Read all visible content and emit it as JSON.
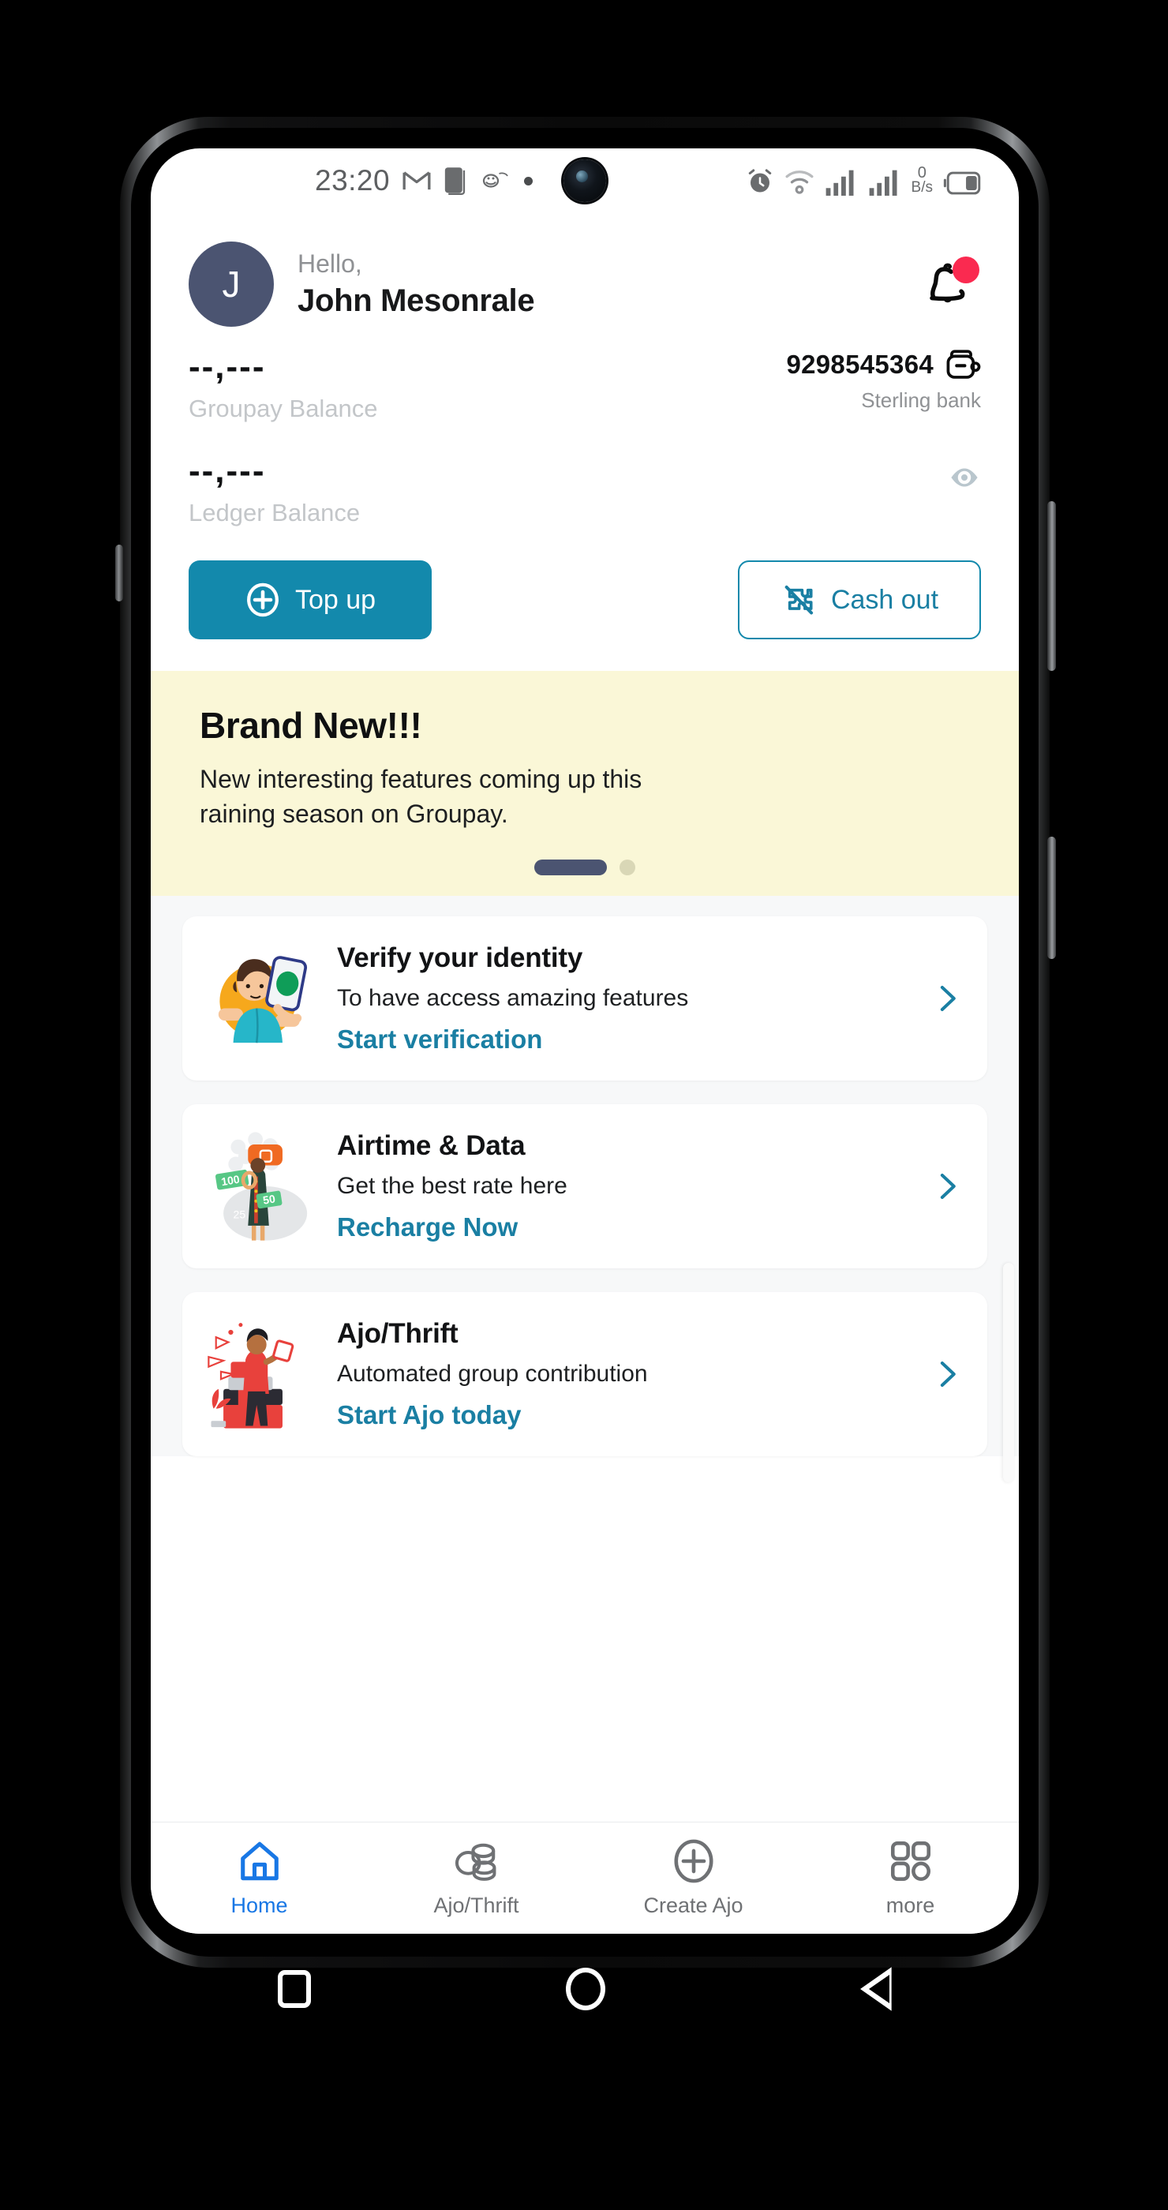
{
  "status_bar": {
    "time": "23:20",
    "left_icons": [
      "gmail-icon",
      "document-icon",
      "app-icon",
      "dot-icon"
    ],
    "right_icons": [
      "alarm-icon",
      "wifi-icon",
      "signal-icon",
      "signal-icon",
      "battery-icon"
    ],
    "data_rate_value": "0",
    "data_rate_unit": "B/s"
  },
  "header": {
    "avatar_initial": "J",
    "greeting": "Hello,",
    "user_name": "John Mesonrale",
    "notification_icon": "bell-icon",
    "has_notification": true
  },
  "balance": {
    "groupay_amount": "--,---",
    "groupay_label": "Groupay Balance",
    "ledger_amount": "--,---",
    "ledger_label": "Ledger Balance",
    "account_number": "9298545364",
    "bank_name": "Sterling bank",
    "wallet_icon": "wallet-icon",
    "eye_icon": "eye-icon"
  },
  "actions": {
    "top_up_label": "Top up",
    "top_up_icon": "plus-circle-icon",
    "cash_out_label": "Cash out",
    "cash_out_icon": "puzzle-slash-icon"
  },
  "promo": {
    "title": "Brand New!!!",
    "text": "New interesting features coming up this raining season on Groupay.",
    "dots_total": 2,
    "dots_active_index": 0
  },
  "cards": [
    {
      "title": "Verify your identity",
      "subtitle": "To have access amazing features",
      "cta": "Start verification",
      "illustration": "person-selfie-verification-illustration",
      "chevron": "chevron-right-icon"
    },
    {
      "title": "Airtime & Data",
      "subtitle": "Get the best rate here",
      "cta": "Recharge Now",
      "illustration": "person-with-money-notes-illustration",
      "chevron": "chevron-right-icon"
    },
    {
      "title": "Ajo/Thrift",
      "subtitle": "Automated group contribution",
      "cta": "Start Ajo today",
      "illustration": "person-with-savings-boxes-illustration",
      "chevron": "chevron-right-icon"
    }
  ],
  "tabbar": {
    "items": [
      {
        "label": "Home",
        "icon": "home-icon",
        "active": true
      },
      {
        "label": "Ajo/Thrift",
        "icon": "coins-icon",
        "active": false
      },
      {
        "label": "Create Ajo",
        "icon": "plus-circle-icon",
        "active": false
      },
      {
        "label": "more",
        "icon": "grid-icon",
        "active": false
      }
    ]
  },
  "android_nav": {
    "recents_icon": "square-icon",
    "home_icon": "circle-icon",
    "back_icon": "triangle-back-icon"
  },
  "colors": {
    "accent_teal": "#1389AC",
    "link_blue": "#1a7fa3",
    "active_blue": "#1877E5",
    "avatar_navy": "#4b5471",
    "banner_yellow": "#FAF7D7",
    "badge_red": "#FA2A50"
  }
}
